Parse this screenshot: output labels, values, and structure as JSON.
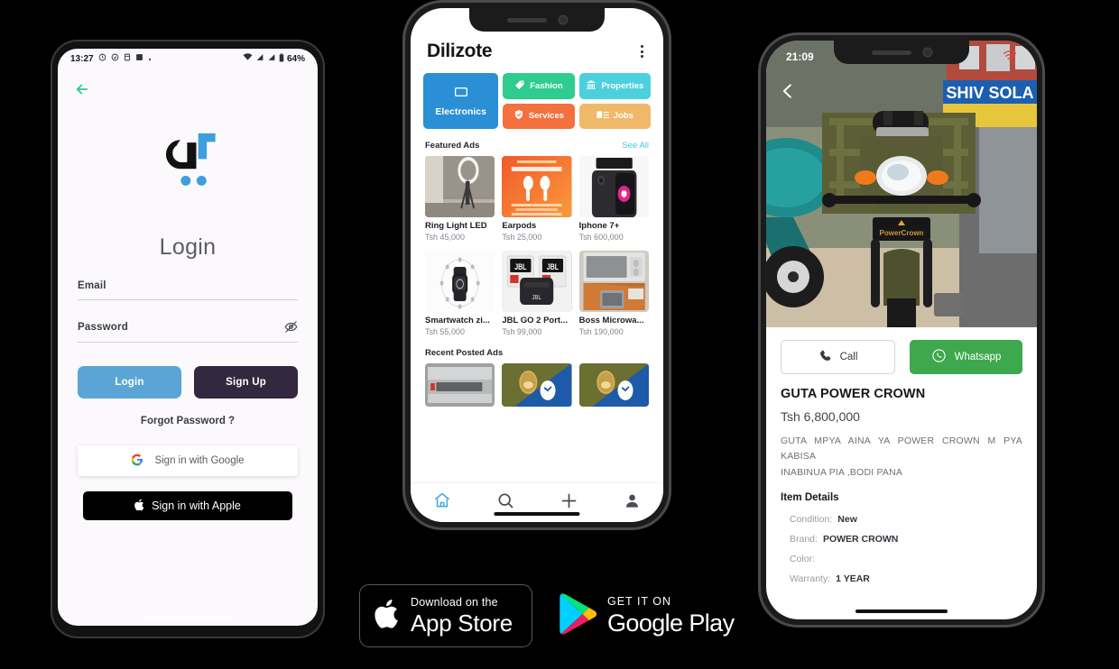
{
  "login_phone": {
    "status": {
      "time": "13:27",
      "battery": "64%"
    },
    "back_icon": "back-arrow-icon",
    "title": "Login",
    "email": {
      "label": "Email",
      "value": "",
      "placeholder": "Email"
    },
    "password": {
      "label": "Password",
      "value": "",
      "placeholder": "Password",
      "toggle_icon": "eye-off-icon"
    },
    "login_button": "Login",
    "signup_button": "Sign Up",
    "forgot_password": "Forgot Password ?",
    "google_button": "Sign in with Google",
    "apple_button": "Sign in with Apple"
  },
  "home_phone": {
    "app_title": "Dilizote",
    "menu_icon": "kebab-menu-icon",
    "categories": [
      {
        "label": "Electronics",
        "color": "#2a8fd4",
        "icon": "monitor-icon"
      },
      {
        "label": "Fashion",
        "color": "#2ecc8f",
        "icon": "tag-icon"
      },
      {
        "label": "Properties",
        "color": "#4dd0dd",
        "icon": "bank-icon"
      },
      {
        "label": "Services",
        "color": "#f4703f",
        "icon": "shield-check-icon"
      },
      {
        "label": "Jobs",
        "color": "#f0b96a",
        "icon": "list-card-icon"
      }
    ],
    "featured": {
      "title": "Featured Ads",
      "see_all": "See All"
    },
    "featured_ads": [
      {
        "name": "Ring Light LED",
        "price": "Tsh 45,000"
      },
      {
        "name": "Earpods",
        "price": "Tsh 25,000"
      },
      {
        "name": "Iphone 7+",
        "price": "Tsh 600,000"
      },
      {
        "name": "Smartwatch zi...",
        "price": "Tsh 55,000"
      },
      {
        "name": "JBL GO 2 Port...",
        "price": "Tsh 99,000"
      },
      {
        "name": "Boss Microwa...",
        "price": "Tsh 190,000"
      }
    ],
    "recent": {
      "title": "Recent Posted Ads"
    },
    "tabs": [
      {
        "name": "home",
        "icon": "home-icon",
        "active": true
      },
      {
        "name": "search",
        "icon": "search-icon",
        "active": false
      },
      {
        "name": "post",
        "icon": "plus-icon",
        "active": false
      },
      {
        "name": "profile",
        "icon": "person-icon",
        "active": false
      }
    ]
  },
  "detail_phone": {
    "status": {
      "time": "21:09",
      "wifi_icon": "wifi-icon"
    },
    "back_icon": "chevron-left-icon",
    "call_button": {
      "label": "Call",
      "icon": "phone-icon"
    },
    "whatsapp_button": {
      "label": "Whatsapp",
      "icon": "whatsapp-icon",
      "color": "#3da84e"
    },
    "title": "GUTA POWER CROWN",
    "price": "Tsh 6,800,000",
    "description_line1": "GUTA MPYA AINA YA POWER CROWN M PYA KABISA",
    "description_line2": "INABINUA PIA ,BODI PANA",
    "details_heading": "Item Details",
    "details": [
      {
        "key": "Condition:",
        "value": "New"
      },
      {
        "key": "Brand:",
        "value": "POWER CROWN"
      },
      {
        "key": "Color:",
        "value": ""
      },
      {
        "key": "Warranty:",
        "value": "1 YEAR"
      }
    ]
  },
  "badges": {
    "appstore": {
      "small": "Download on the",
      "big": "App Store",
      "icon": "apple-icon"
    },
    "googleplay": {
      "small": "GET IT ON",
      "big": "Google Play",
      "icon": "google-play-icon"
    }
  }
}
